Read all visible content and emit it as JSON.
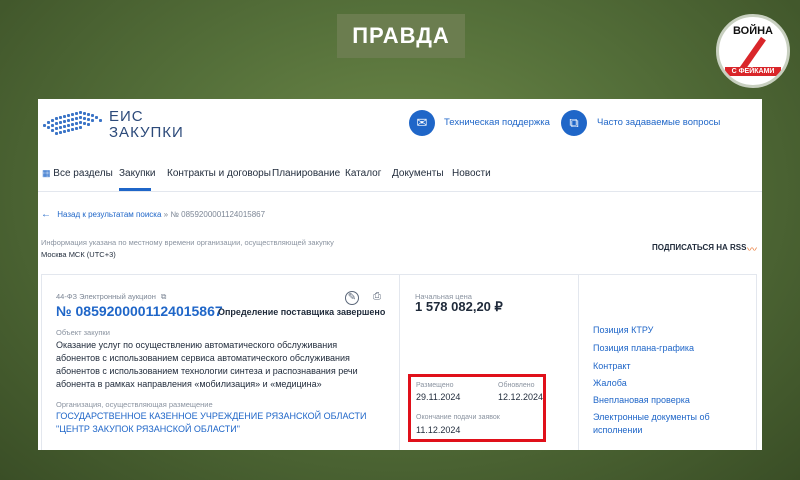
{
  "overlay": {
    "badge_text": "ПРАВДА",
    "logo_top": "ВОЙНА",
    "logo_bottom": "С ФЕЙКАМИ"
  },
  "header": {
    "logo_line1": "ЕИС",
    "logo_line2": "ЗАКУПКИ",
    "support_label": "Техническая поддержка",
    "faq_label": "Часто задаваемые вопросы",
    "support_icon": "mail-icon",
    "faq_icon": "copy-icon"
  },
  "nav": {
    "all_sections": "Все разделы",
    "items": [
      "Закупки",
      "Контракты и договоры",
      "Планирование",
      "Каталог",
      "Документы",
      "Новости"
    ]
  },
  "breadcrumb": {
    "back": "Назад к результатам поиска",
    "separator": "»",
    "number": "№ 0859200001124015867"
  },
  "info": {
    "line1": "Информация указана по местному времени организации, осуществляющей закупку",
    "line2": "Москва МСК (UTC+3)",
    "rss": "ПОДПИСАТЬСЯ НА RSS"
  },
  "procurement": {
    "law": "44-ФЗ Электронный аукцион",
    "number": "№ 0859200001124015867",
    "status": "Определение поставщика завершено",
    "object_label": "Объект закупки",
    "object_text": "Оказание услуг по осуществлению автоматического обслуживания абонентов с использованием сервиса автоматического обслуживания абонентов с использованием технологии синтеза и распознавания речи абонента в рамках направления «мобилизация» и «медицина»",
    "org_label": "Организация, осуществляющая размещение",
    "org_text": "ГОСУДАРСТВЕННОЕ КАЗЕННОЕ УЧРЕЖДЕНИЕ РЯЗАНСКОЙ ОБЛАСТИ \"ЦЕНТР ЗАКУПОК РЯЗАНСКОЙ ОБЛАСТИ\""
  },
  "price": {
    "label": "Начальная цена",
    "value": "1 578 082,20 ₽"
  },
  "dates": {
    "posted_label": "Размещено",
    "posted": "29.11.2024",
    "updated_label": "Обновлено",
    "updated": "12.12.2024",
    "deadline_label": "Окончание подачи заявок",
    "deadline": "11.12.2024"
  },
  "right_links": [
    "Позиция КТРУ",
    "Позиция плана-графика",
    "Контракт",
    "Жалоба",
    "Внеплановая проверка",
    "Электронные документы об исполнении"
  ]
}
